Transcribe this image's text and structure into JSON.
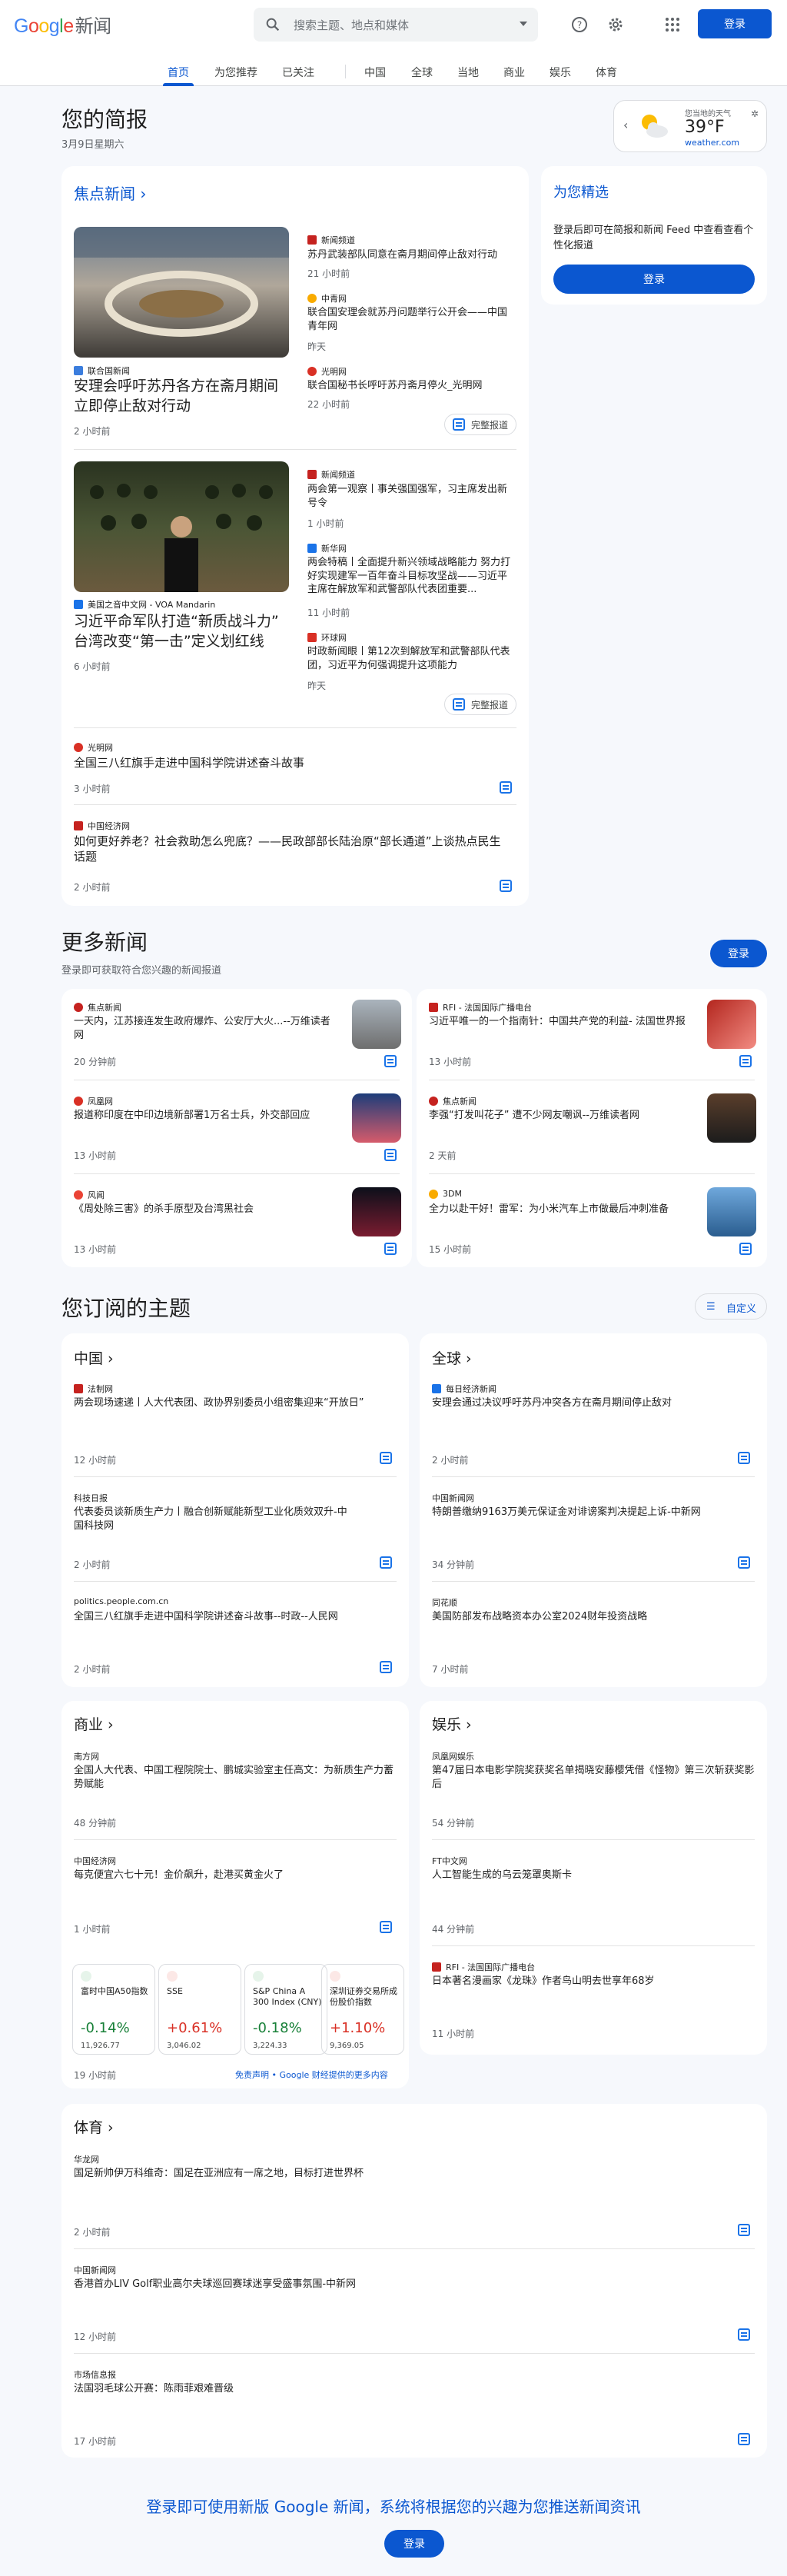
{
  "header": {
    "logo_google": "Google",
    "logo_news": "新闻",
    "search_placeholder": "搜索主题、地点和媒体",
    "signin": "登录"
  },
  "nav": {
    "tabs": [
      "首页",
      "为您推荐",
      "已关注",
      "中国",
      "全球",
      "当地",
      "商业",
      "娱乐",
      "体育"
    ]
  },
  "briefing": {
    "title": "您的简报",
    "date": "3月9日星期六"
  },
  "weather": {
    "label": "您当地的天气",
    "temp": "39°F",
    "source": "weather.com"
  },
  "picks": {
    "title": "为您精选",
    "desc": "登录后即可在简报和新闻 Feed 中查看查看个性化报道",
    "signin": "登录"
  },
  "top": {
    "title": "焦点新闻",
    "full": "完整报道",
    "s1": {
      "src": "联合国新闻",
      "title": "安理会呼吁苏丹各方在斋月期间立即停止敌对行动",
      "time": "2 小时前",
      "rel": [
        {
          "src": "新闻频道",
          "title": "苏丹武装部队同意在斋月期间停止敌对行动",
          "time": "21 小时前"
        },
        {
          "src": "中青网",
          "title": "联合国安理会就苏丹问题举行公开会——中国青年网",
          "time": "昨天"
        },
        {
          "src": "光明网",
          "title": "联合国秘书长呼吁苏丹斋月停火_光明网",
          "time": "22 小时前"
        }
      ]
    },
    "s2": {
      "src": "美国之音中文网 - VOA Mandarin",
      "title": "习近平命军队打造“新质战斗力” 台湾改变“第一击”定义划红线",
      "time": "6 小时前",
      "rel": [
        {
          "src": "新闻频道",
          "title": "两会第一观察丨事关强国强军，习主席发出新号令",
          "time": "1 小时前"
        },
        {
          "src": "新华网",
          "title": "两会特稿丨全面提升新兴领域战略能力 努力打好实现建军一百年奋斗目标攻坚战——习近平主席在解放军和武警部队代表团重要...",
          "time": "11 小时前"
        },
        {
          "src": "环球网",
          "title": "时政新闻眼丨第12次到解放军和武警部队代表团，习近平为何强调提升这项能力",
          "time": "昨天"
        }
      ]
    },
    "s3": {
      "src": "光明网",
      "title": "全国三八红旗手走进中国科学院讲述奋斗故事",
      "time": "3 小时前"
    },
    "s4": {
      "src": "中国经济网",
      "title": "如何更好养老？社会救助怎么兜底？——民政部部长陆治原“部长通道”上谈热点民生话题",
      "time": "2 小时前"
    }
  },
  "more": {
    "title": "更多新闻",
    "sub": "登录即可获取符合您兴趣的新闻报道",
    "signin": "登录",
    "items": [
      {
        "src": "焦点新闻",
        "title": "一天内，江苏接连发生政府爆炸、公安厅大火...--万维读者网",
        "time": "20 分钟前"
      },
      {
        "src": "RFI - 法国国际广播电台",
        "title": "习近平唯一的一个指南针：中国共产党的利益- 法国世界报",
        "time": "13 小时前"
      },
      {
        "src": "凤凰网",
        "title": "报道称印度在中印边境新部署1万名士兵，外交部回应",
        "time": "13 小时前"
      },
      {
        "src": "焦点新闻",
        "title": "李强“打发叫花子” 遭不少网友嘲讽--万维读者网",
        "time": "2 天前"
      },
      {
        "src": "风闻",
        "title": "《周处除三害》的杀手原型及台湾黑社会",
        "time": "13 小时前"
      },
      {
        "src": "3DM",
        "title": "全力以赴干好！雷军：为小米汽车上市做最后冲刺准备",
        "time": "15 小时前"
      }
    ]
  },
  "subs": {
    "title": "您订阅的主题",
    "customize": "自定义"
  },
  "china": {
    "title": "中国",
    "items": [
      {
        "src": "法制网",
        "title": "两会现场速递丨人大代表团、政协界别委员小组密集迎来“开放日”",
        "time": "12 小时前"
      },
      {
        "src": "科技日报",
        "title": "代表委员谈新质生产力丨融合创新赋能新型工业化质效双升-中国科技网",
        "time": "2 小时前"
      },
      {
        "src": "politics.people.com.cn",
        "title": "全国三八红旗手走进中国科学院讲述奋斗故事--时政--人民网",
        "time": "2 小时前"
      }
    ]
  },
  "world": {
    "title": "全球",
    "items": [
      {
        "src": "每日经济新闻",
        "title": "安理会通过决议呼吁苏丹冲突各方在斋月期间停止敌对",
        "time": "2 小时前"
      },
      {
        "src": "中国新闻网",
        "title": "特朗普缴纳9163万美元保证金对诽谤案判决提起上诉-中新网",
        "time": "34 分钟前"
      },
      {
        "src": "同花顺",
        "title": "美国防部发布战略资本办公室2024财年投资战略",
        "time": "7 小时前"
      }
    ]
  },
  "biz": {
    "title": "商业",
    "items": [
      {
        "src": "南方网",
        "title": "全国人大代表、中国工程院院士、鹏城实验室主任高文：为新质生产力蓄势赋能",
        "time": "48 分钟前"
      },
      {
        "src": "中国经济网",
        "title": "每克便宜六七十元！金价飙升，赴港买黄金火了",
        "time": "1 小时前"
      }
    ],
    "stocks": [
      {
        "name": "富时中国A50指数",
        "pct": "-0.14%",
        "val": "11,926.77",
        "dir": "up"
      },
      {
        "name": "SSE",
        "pct": "+0.61%",
        "val": "3,046.02",
        "dir": "dn"
      },
      {
        "name": "S&P China A 300 Index (CNY)",
        "pct": "-0.18%",
        "val": "3,224.33",
        "dir": "up"
      },
      {
        "name": "深圳证券交易所成份股价指数",
        "pct": "+1.10%",
        "val": "9,369.05",
        "dir": "dn"
      }
    ],
    "stock_time": "19 小时前",
    "disclaimer": "免责声明 • Google 财经提供的更多内容"
  },
  "ent": {
    "title": "娱乐",
    "items": [
      {
        "src": "凤凰网娱乐",
        "title": "第47届日本电影学院奖获奖名单揭晓安藤樱凭借《怪物》第三次斩获奖影后",
        "time": "54 分钟前"
      },
      {
        "src": "FT中文网",
        "title": "人工智能生成的乌云笼罩奥斯卡",
        "time": "44 分钟前"
      },
      {
        "src": "RFI - 法国国际广播电台",
        "title": "日本著名漫画家《龙珠》作者鸟山明去世享年68岁",
        "time": "11 小时前"
      }
    ]
  },
  "sports": {
    "title": "体育",
    "items": [
      {
        "src": "华龙网",
        "title": "国足新帅伊万科维奇：国足在亚洲应有一席之地，目标打进世界杯",
        "time": "2 小时前"
      },
      {
        "src": "中国新闻网",
        "title": "香港首办LIV Golf职业高尔夫球巡回赛球迷享受盛事氛围-中新网",
        "time": "12 小时前"
      },
      {
        "src": "市场信息报",
        "title": "法国羽毛球公开赛：陈雨菲艰难晋级",
        "time": "17 小时前"
      }
    ]
  },
  "footer": {
    "text": "登录即可使用新版 Google 新闻，系统将根据您的兴趣为您推送新闻资讯",
    "signin": "登录"
  },
  "colors": {
    "accent": "#0b57d0",
    "up": "#188038",
    "down": "#d93025"
  }
}
